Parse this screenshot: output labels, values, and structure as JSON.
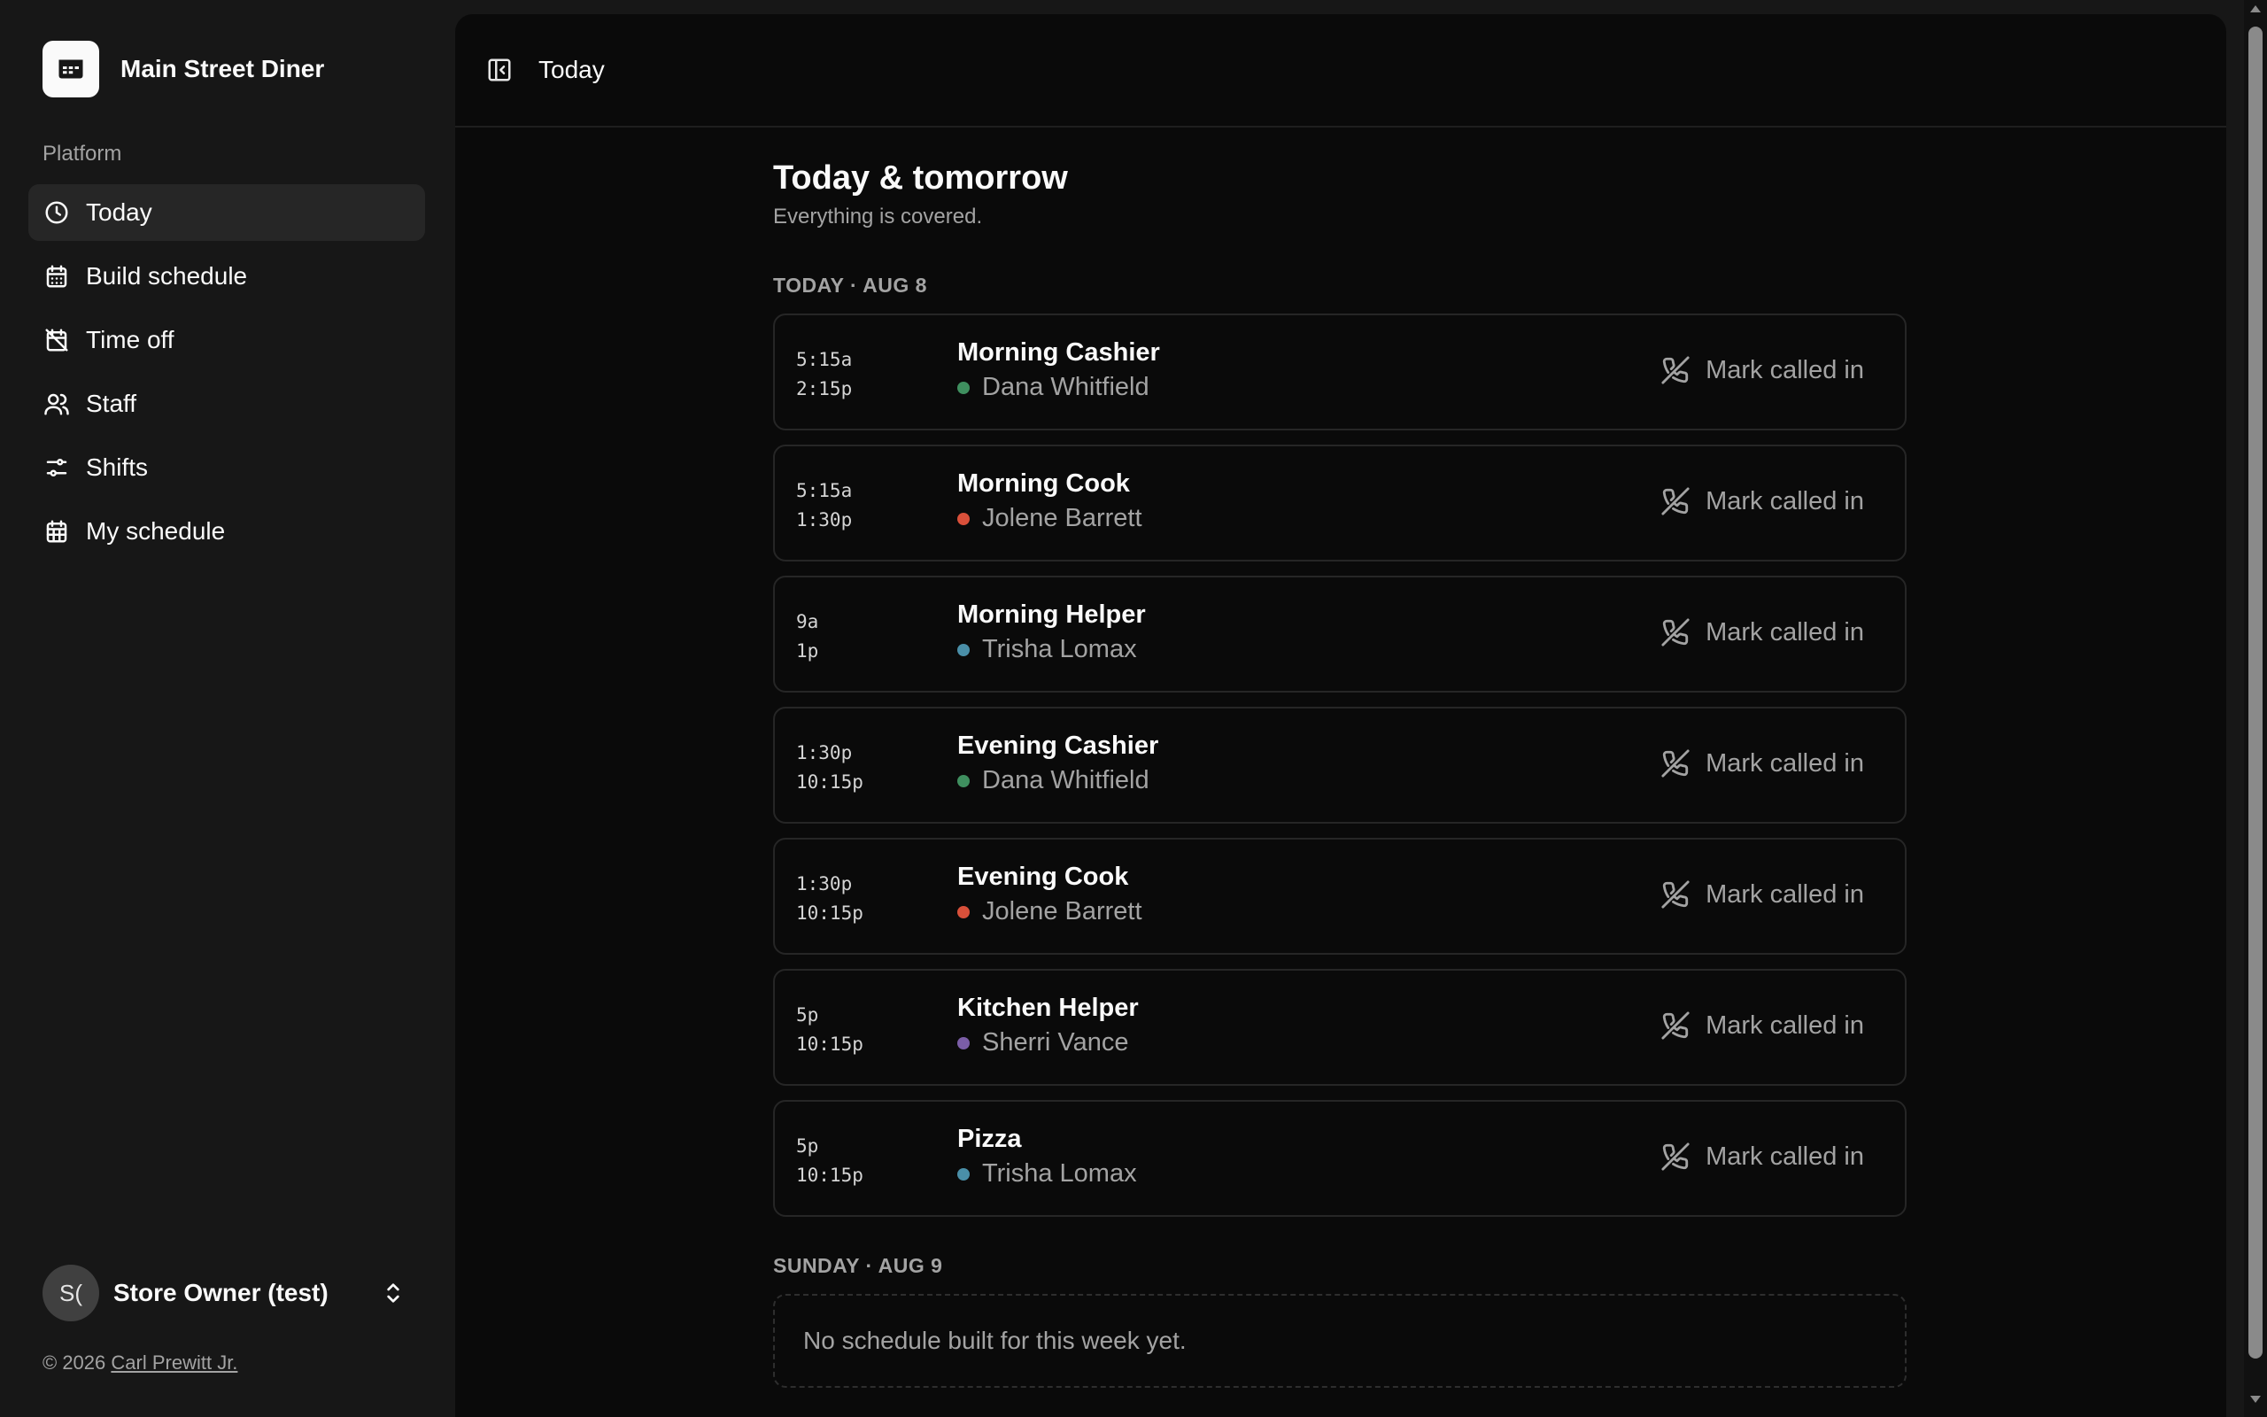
{
  "brand": {
    "name": "Main Street Diner"
  },
  "sidebar": {
    "group_label": "Platform",
    "items": [
      {
        "label": "Today",
        "icon": "clock-icon",
        "active": true
      },
      {
        "label": "Build schedule",
        "icon": "calendar-days-icon"
      },
      {
        "label": "Time off",
        "icon": "calendar-off-icon"
      },
      {
        "label": "Staff",
        "icon": "users-icon"
      },
      {
        "label": "Shifts",
        "icon": "sliders-icon"
      },
      {
        "label": "My schedule",
        "icon": "calendar-grid-icon"
      }
    ],
    "user": {
      "initials": "S(",
      "name": "Store Owner (test)"
    },
    "footer": {
      "copyright": "© 2026",
      "author": "Carl Prewitt Jr."
    }
  },
  "header": {
    "title": "Today"
  },
  "main": {
    "title": "Today & tomorrow",
    "subtitle": "Everything is covered.",
    "today_label": "TODAY · AUG 8",
    "call_in_label": "Mark called in",
    "shifts": [
      {
        "start": "5:15a",
        "end": "2:15p",
        "role": "Morning Cashier",
        "person": "Dana Whitfield",
        "color": "#3f8f5f"
      },
      {
        "start": "5:15a",
        "end": "1:30p",
        "role": "Morning Cook",
        "person": "Jolene Barrett",
        "color": "#d9503a"
      },
      {
        "start": "9a",
        "end": "1p",
        "role": "Morning Helper",
        "person": "Trisha Lomax",
        "color": "#4a8fa8"
      },
      {
        "start": "1:30p",
        "end": "10:15p",
        "role": "Evening Cashier",
        "person": "Dana Whitfield",
        "color": "#3f8f5f"
      },
      {
        "start": "1:30p",
        "end": "10:15p",
        "role": "Evening Cook",
        "person": "Jolene Barrett",
        "color": "#d9503a"
      },
      {
        "start": "5p",
        "end": "10:15p",
        "role": "Kitchen Helper",
        "person": "Sherri Vance",
        "color": "#7b5ea7"
      },
      {
        "start": "5p",
        "end": "10:15p",
        "role": "Pizza",
        "person": "Trisha Lomax",
        "color": "#4a8fa8"
      }
    ],
    "tomorrow_label": "SUNDAY · AUG 9",
    "tomorrow_empty": "No schedule built for this week yet."
  }
}
